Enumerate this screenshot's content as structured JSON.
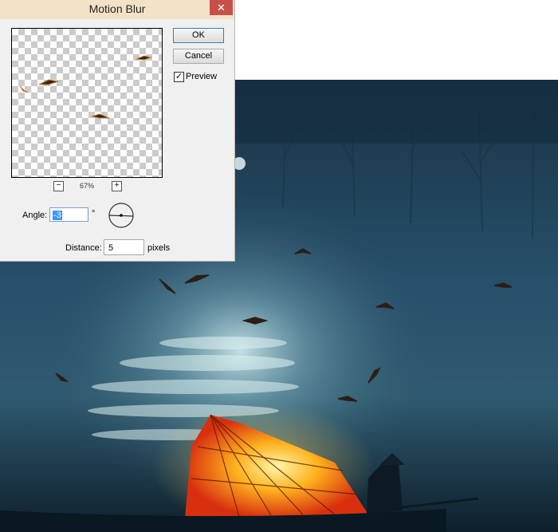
{
  "dialog": {
    "title": "Motion Blur",
    "close_icon": "close-icon",
    "ok_label": "OK",
    "cancel_label": "Cancel",
    "preview_label": "Preview",
    "preview_checked": true,
    "zoom_out_label": "−",
    "zoom_in_label": "+",
    "zoom_level": "67%",
    "angle_label": "Angle:",
    "angle_value": "-3",
    "degree_symbol": "°",
    "distance_label": "Distance:",
    "distance_value": "5",
    "distance_unit": "pixels"
  },
  "colors": {
    "titlebar": "#f3e2c6",
    "close_button": "#c7504a",
    "selection": "#3399ff",
    "sail_glow": "#ff9a1a",
    "water_dark": "#0f2a3a"
  }
}
